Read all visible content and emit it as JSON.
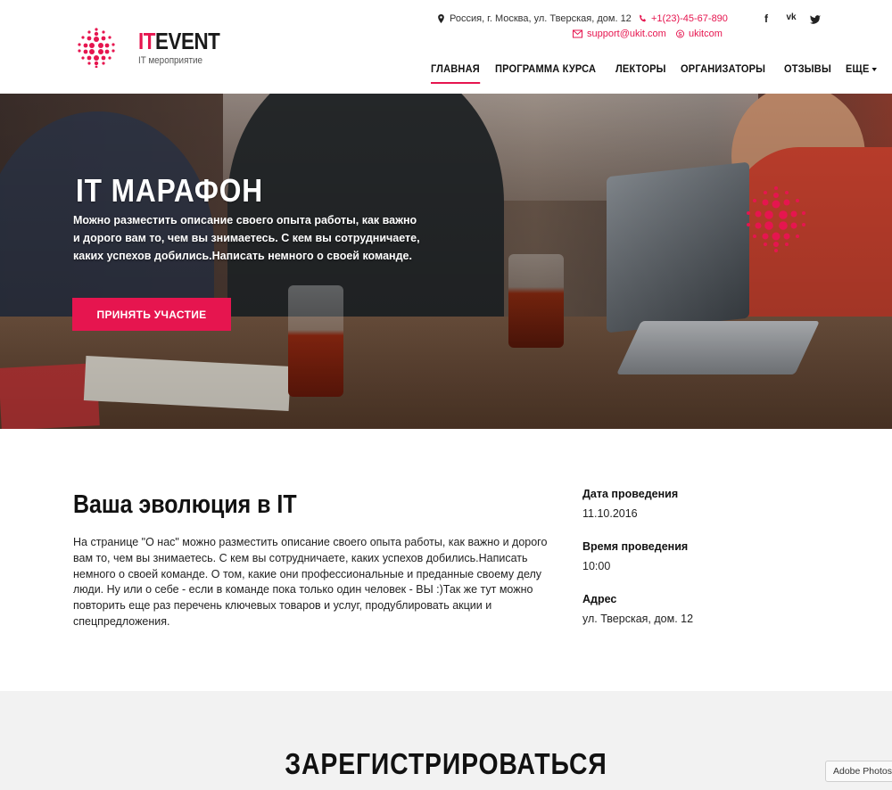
{
  "brand": {
    "title_accent": "IT",
    "title_rest": "EVENT",
    "subtitle": "IT мероприятие"
  },
  "contacts": {
    "address": "Россия, г. Москва, ул. Тверская, дом. 12",
    "phone": "+1(23)-45-67-890",
    "email": "support@ukit.com",
    "skype": "ukitcom"
  },
  "social": [
    "f",
    "vk",
    "tw"
  ],
  "nav": {
    "items": [
      "ГЛАВНАЯ",
      "ПРОГРАММА КУРСА",
      "ЛЕКТОРЫ",
      "ОРГАНИЗАТОРЫ",
      "ОТЗЫВЫ"
    ],
    "more": "ЕЩЕ",
    "active_index": 0
  },
  "hero": {
    "title": "IT МАРАФОН",
    "text": "Можно разместить описание своего опыта работы, как важно и дорого вам то, чем вы знимаетесь. С кем вы сотрудничаете, каких успехов добились.Написать немного о своей команде.",
    "button": "ПРИНЯТЬ УЧАСТИЕ"
  },
  "about": {
    "title": "Ваша эволюция в IT",
    "text": "На странице \"О нас\" можно разместить описание своего опыта работы, как важно и дорого вам то, чем вы знимаетесь. С кем вы сотрудничаете, каких успехов добились.Написать немного о своей команде. О том, какие они профессиональные и преданные своему делу люди. Ну или о себе - если в команде пока только один человек - ВЫ :)Так же тут можно повторить еще раз перечень ключевых товаров и услуг, продублировать акции и спецпредложения."
  },
  "info": {
    "date_label": "Дата проведения",
    "date_value": "11.10.2016",
    "time_label": "Время проведения",
    "time_value": "10:00",
    "address_label": "Адрес",
    "address_value": "ул. Тверская, дом. 12"
  },
  "register": {
    "title": "ЗАРЕГИСТРИРОВАТЬСЯ"
  },
  "overlay": {
    "adobe_label": "Adobe Photos"
  },
  "colors": {
    "accent": "#e6154f",
    "section_bg": "#f2f2f2"
  }
}
